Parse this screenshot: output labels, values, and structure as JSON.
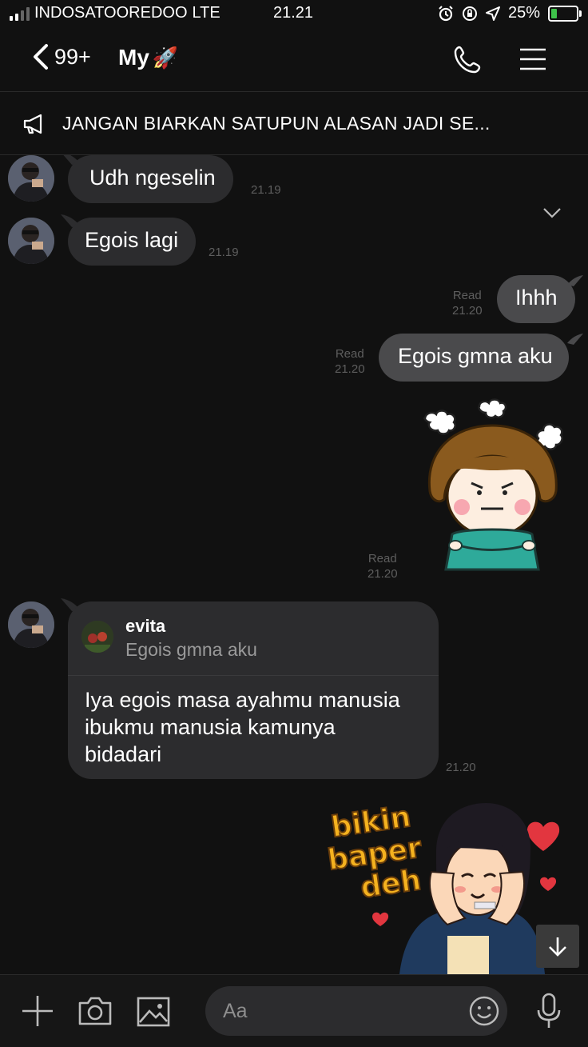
{
  "status_bar": {
    "carrier": "INDOSATOOREDOO",
    "network": "LTE",
    "time": "21.21",
    "battery_percent": "25%",
    "battery_level": 0.25
  },
  "header": {
    "back_count": "99+",
    "chat_name": "My",
    "chat_emoji": "🚀"
  },
  "announcement": {
    "text": "JANGAN BIARKAN SATUPUN ALASAN JADI SE..."
  },
  "messages": [
    {
      "side": "in",
      "text": "Udh ngeselin",
      "time": "21.19"
    },
    {
      "side": "in",
      "text": "Egois lagi",
      "time": "21.19"
    },
    {
      "side": "out",
      "text": "Ihhh",
      "status": "Read",
      "time": "21.20"
    },
    {
      "side": "out",
      "text": "Egois gmna aku",
      "status": "Read",
      "time": "21.20"
    },
    {
      "side": "out",
      "type": "sticker",
      "status": "Read",
      "time": "21.20"
    },
    {
      "side": "in",
      "reply_to": {
        "name": "evita",
        "text": "Egois gmna aku"
      },
      "text_lines": [
        "Iya egois masa ayahmu manusia",
        "ibukmu manusia kamunya",
        "bidadari"
      ],
      "time": "21.20"
    },
    {
      "side": "out",
      "type": "sticker",
      "sticker_text": [
        "bikin",
        "baper",
        "deh"
      ]
    }
  ],
  "input": {
    "placeholder": "Aa"
  },
  "icons": {
    "back": "chevron-left-icon",
    "call": "phone-icon",
    "menu": "hamburger-menu-icon",
    "announcement": "megaphone-icon",
    "expand": "chevron-down-icon",
    "add": "plus-icon",
    "camera": "camera-icon",
    "gallery": "image-icon",
    "emoji": "smiley-icon",
    "voice": "microphone-icon",
    "scroll_down": "arrow-down-icon"
  },
  "colors": {
    "background": "#111111",
    "bubble_in": "#2c2c2e",
    "bubble_out": "#4a4a4c",
    "battery_fill": "#3ec24a"
  }
}
